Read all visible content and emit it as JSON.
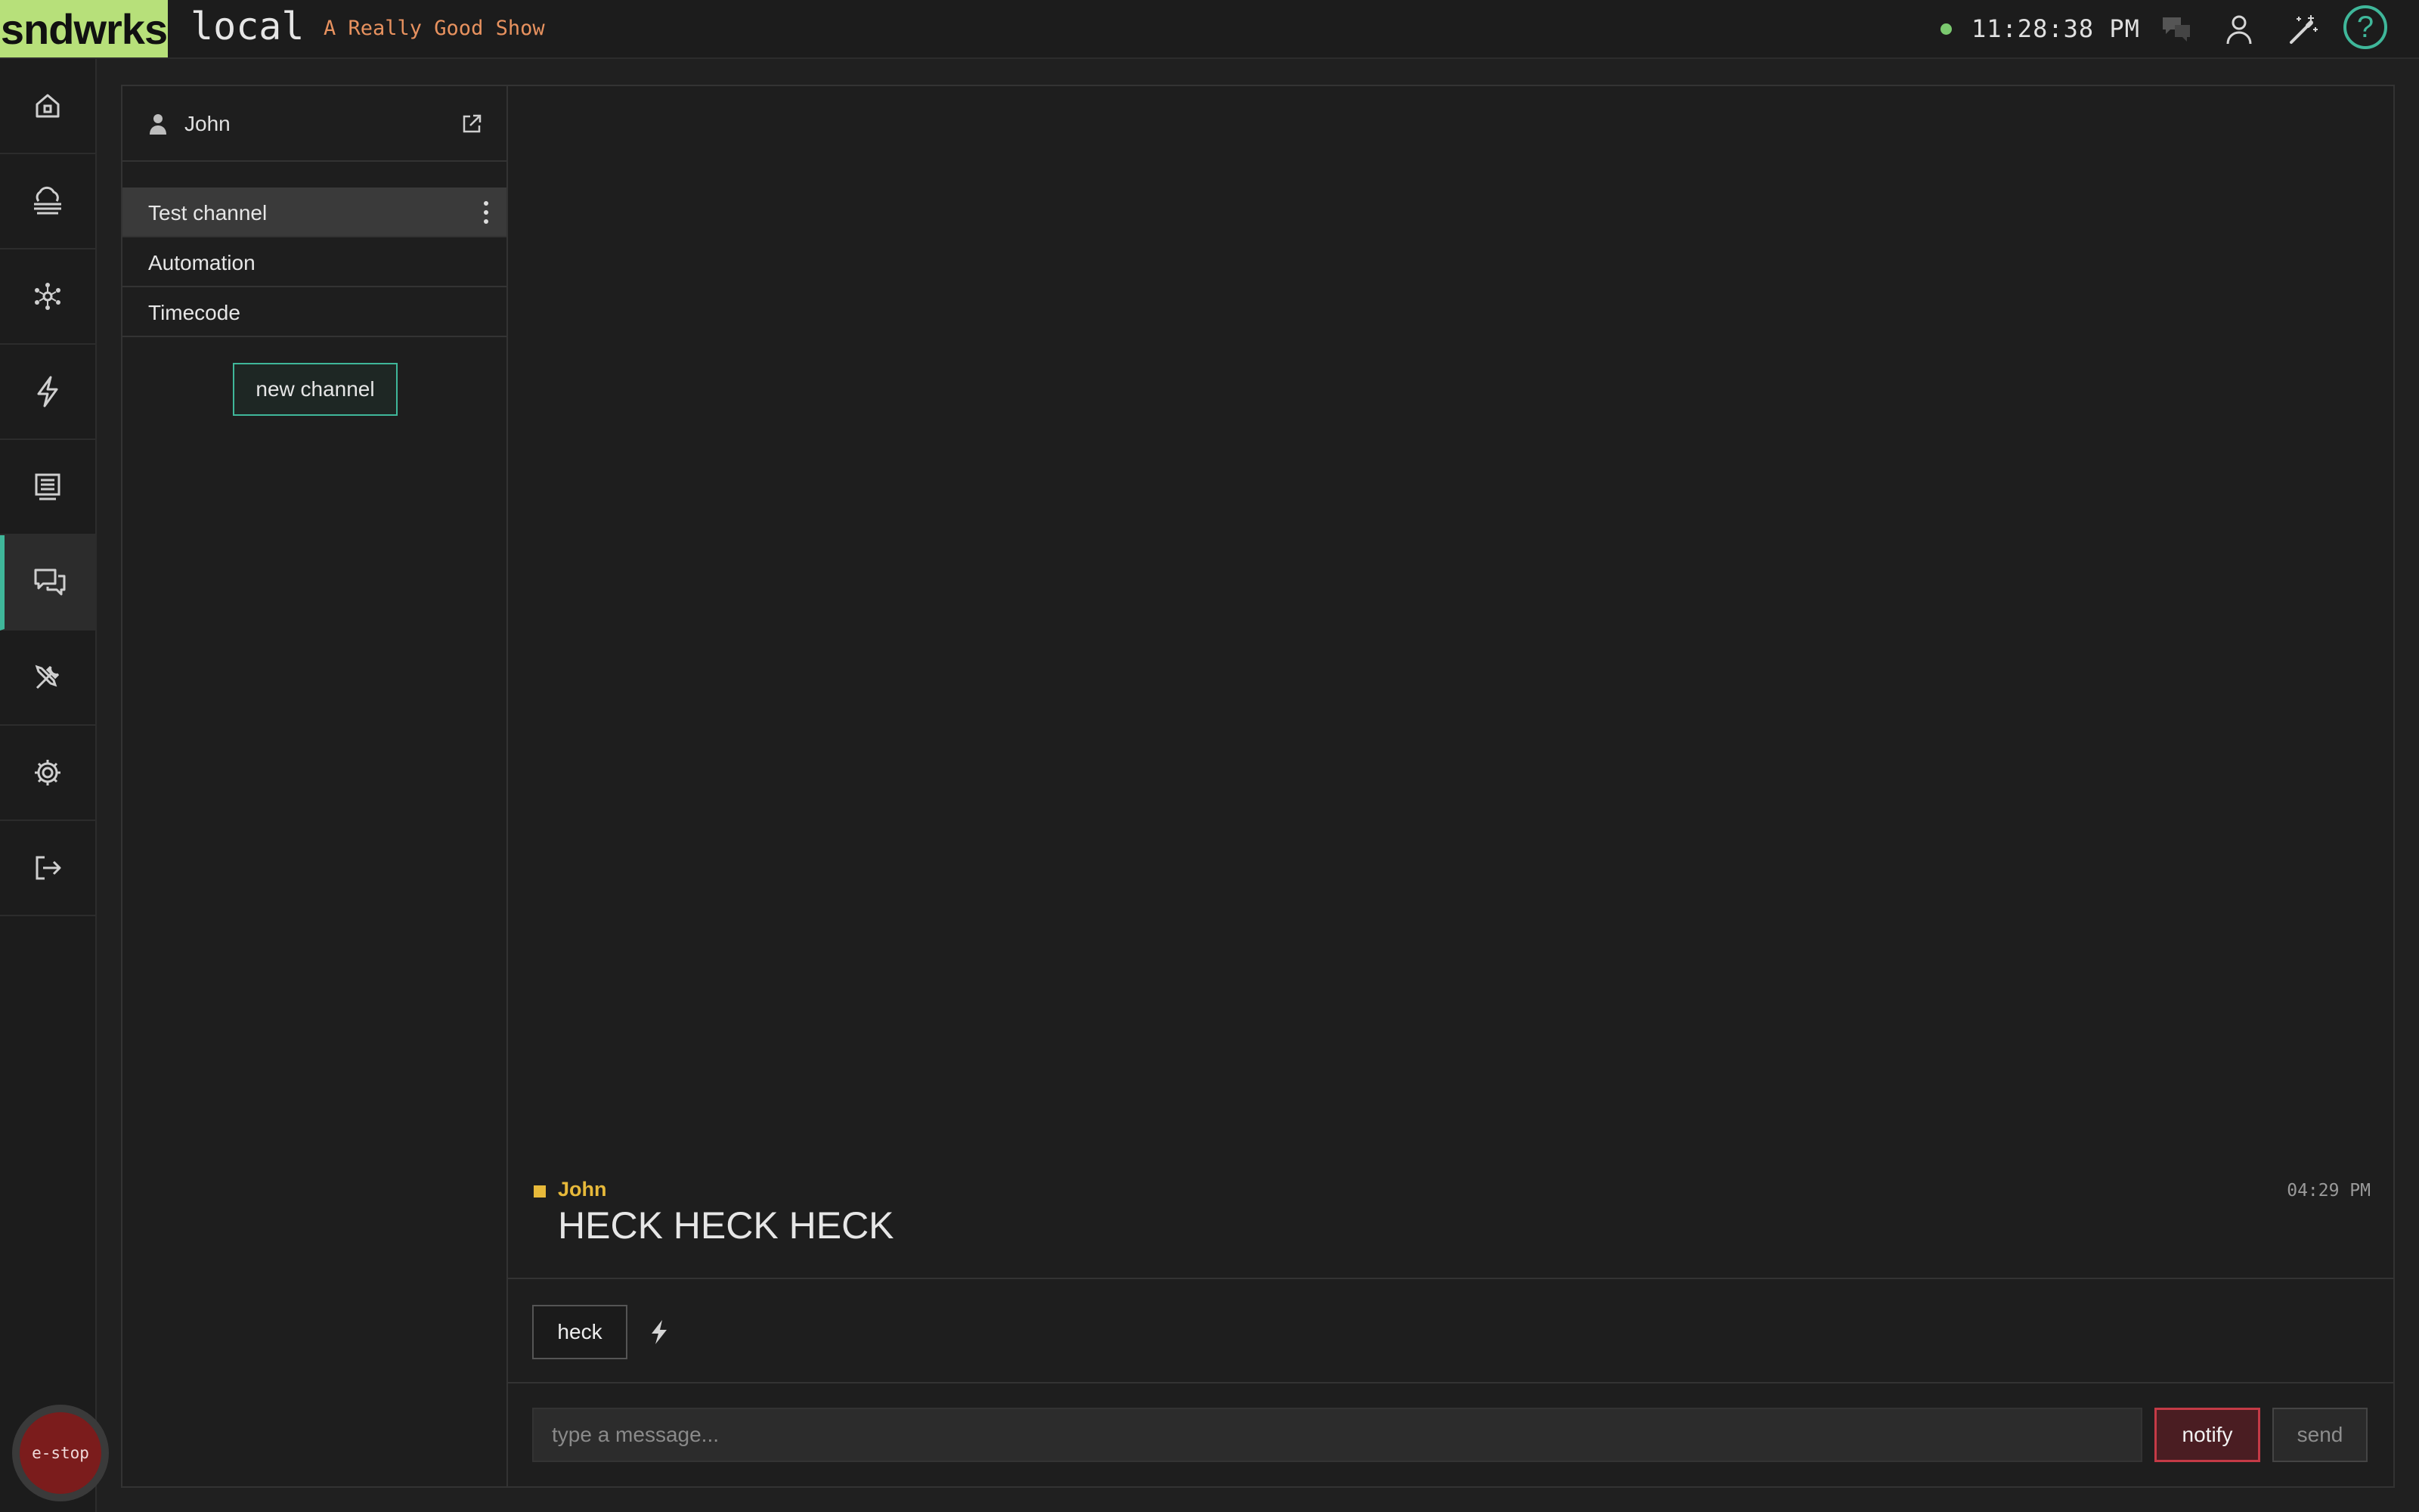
{
  "header": {
    "brand": "sndwrks",
    "environment": "local",
    "show_name": "A Really Good Show",
    "clock": "11:28:38 PM",
    "icons": [
      "status-dot",
      "chat-icon",
      "user-icon",
      "magic-wand-icon",
      "help-icon"
    ],
    "help_label": "?"
  },
  "nav": {
    "items": [
      {
        "icon": "home-icon"
      },
      {
        "icon": "cloud-stack-icon"
      },
      {
        "icon": "network-icon"
      },
      {
        "icon": "lightning-icon"
      },
      {
        "icon": "display-icon"
      },
      {
        "icon": "chat-icon",
        "active": true
      },
      {
        "icon": "tools-icon"
      },
      {
        "icon": "gear-icon"
      },
      {
        "icon": "logout-icon"
      }
    ],
    "estop_label": "e-stop"
  },
  "channels": {
    "user": "John",
    "items": [
      {
        "label": "Test channel",
        "active": true
      },
      {
        "label": "Automation"
      },
      {
        "label": "Timecode"
      }
    ],
    "new_channel_label": "new channel"
  },
  "chat": {
    "messages": [
      {
        "author": "John",
        "time": "04:29 PM",
        "text": "HECK HECK HECK"
      }
    ],
    "quick_replies": [
      "heck"
    ],
    "input_placeholder": "type a message...",
    "notify_label": "notify",
    "send_label": "send"
  },
  "colors": {
    "brand_bg": "#b7e07a",
    "accent": "#3fb79a",
    "show_name": "#e8925f",
    "author": "#e7b93a",
    "notify_border": "#c43a46",
    "estop": "#7b1c1c"
  }
}
